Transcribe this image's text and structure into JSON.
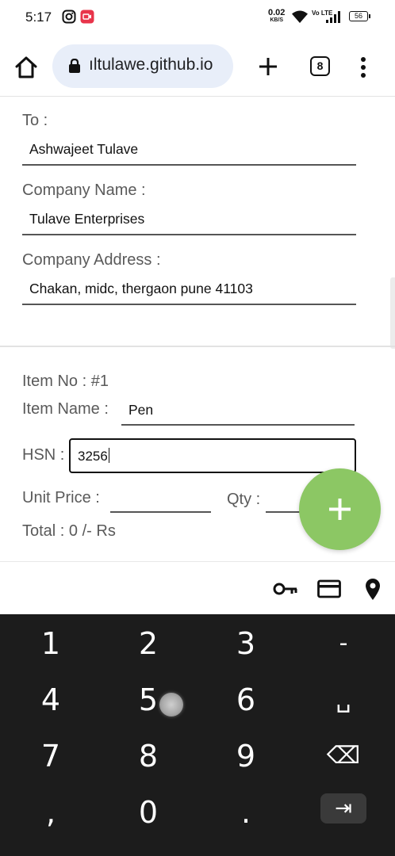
{
  "status_bar": {
    "time": "5:17",
    "net_speed_value": "0.02",
    "net_speed_unit": "KB/S",
    "volte_label": "Vo LTE",
    "battery": "56",
    "icons": [
      "instagram-icon",
      "screen-record-icon",
      "wifi-icon",
      "signal-icon",
      "battery-icon"
    ]
  },
  "browser": {
    "url": "ıltulawe.github.io",
    "tab_count": "8",
    "icons": [
      "home-icon",
      "lock-icon",
      "new-tab-plus-icon",
      "tabs-icon",
      "more-menu-icon"
    ]
  },
  "form": {
    "to_label": "To :",
    "to_value": "Ashwajeet Tulave",
    "company_name_label": "Company Name :",
    "company_name_value": "Tulave Enterprises",
    "company_address_label": "Company Address :",
    "company_address_value": "Chakan, midc, thergaon pune 41103"
  },
  "item": {
    "item_no_label": "Item No : #1",
    "item_name_label": "Item Name :",
    "item_name_value": "Pen",
    "hsn_label": "HSN :",
    "hsn_value": "3256",
    "unit_price_label": "Unit Price :",
    "unit_price_value": "",
    "qty_label": "Qty :",
    "qty_value": "",
    "total_label": "Total : 0 /- Rs"
  },
  "fab": {
    "label": "+",
    "color": "#8cc764"
  },
  "autofill": {
    "icons": [
      "key-icon",
      "credit-card-icon",
      "location-pin-icon"
    ]
  },
  "keyboard": {
    "keys": [
      "1",
      "2",
      "3",
      "-",
      "4",
      "5",
      "6",
      "␣",
      "7",
      "8",
      "9",
      "⌫",
      ",",
      "0",
      ".",
      "⇥"
    ]
  }
}
